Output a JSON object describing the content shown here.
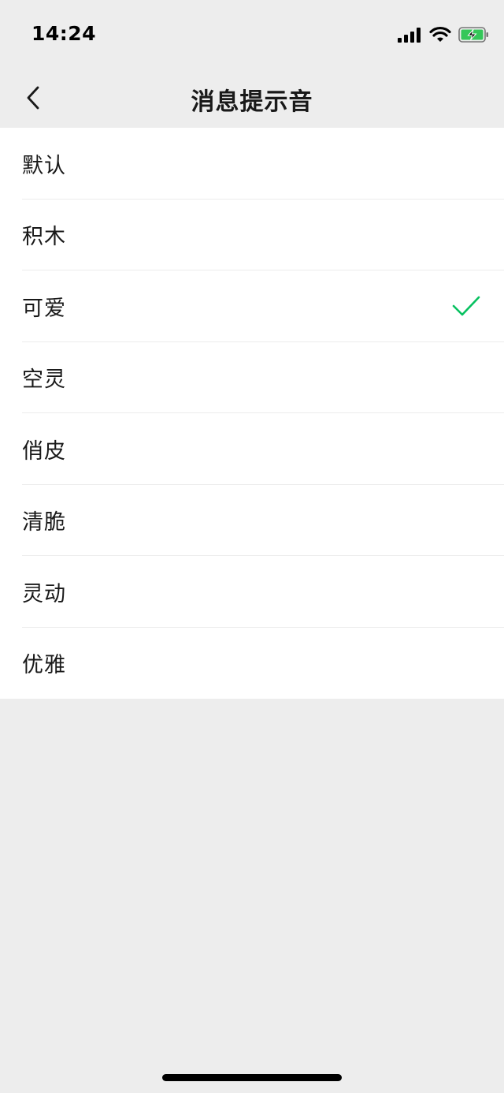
{
  "status_bar": {
    "time": "14:24",
    "icons": [
      "signal-icon",
      "wifi-icon",
      "battery-charging-icon"
    ]
  },
  "nav": {
    "title": "消息提示音",
    "back_icon": "chevron-left-icon"
  },
  "tones": [
    {
      "label": "默认",
      "selected": false
    },
    {
      "label": "积木",
      "selected": false
    },
    {
      "label": "可爱",
      "selected": true
    },
    {
      "label": "空灵",
      "selected": false
    },
    {
      "label": "俏皮",
      "selected": false
    },
    {
      "label": "清脆",
      "selected": false
    },
    {
      "label": "灵动",
      "selected": false
    },
    {
      "label": "优雅",
      "selected": false
    }
  ],
  "colors": {
    "accent": "#07c160",
    "background": "#ededed",
    "battery": "#34c759"
  }
}
